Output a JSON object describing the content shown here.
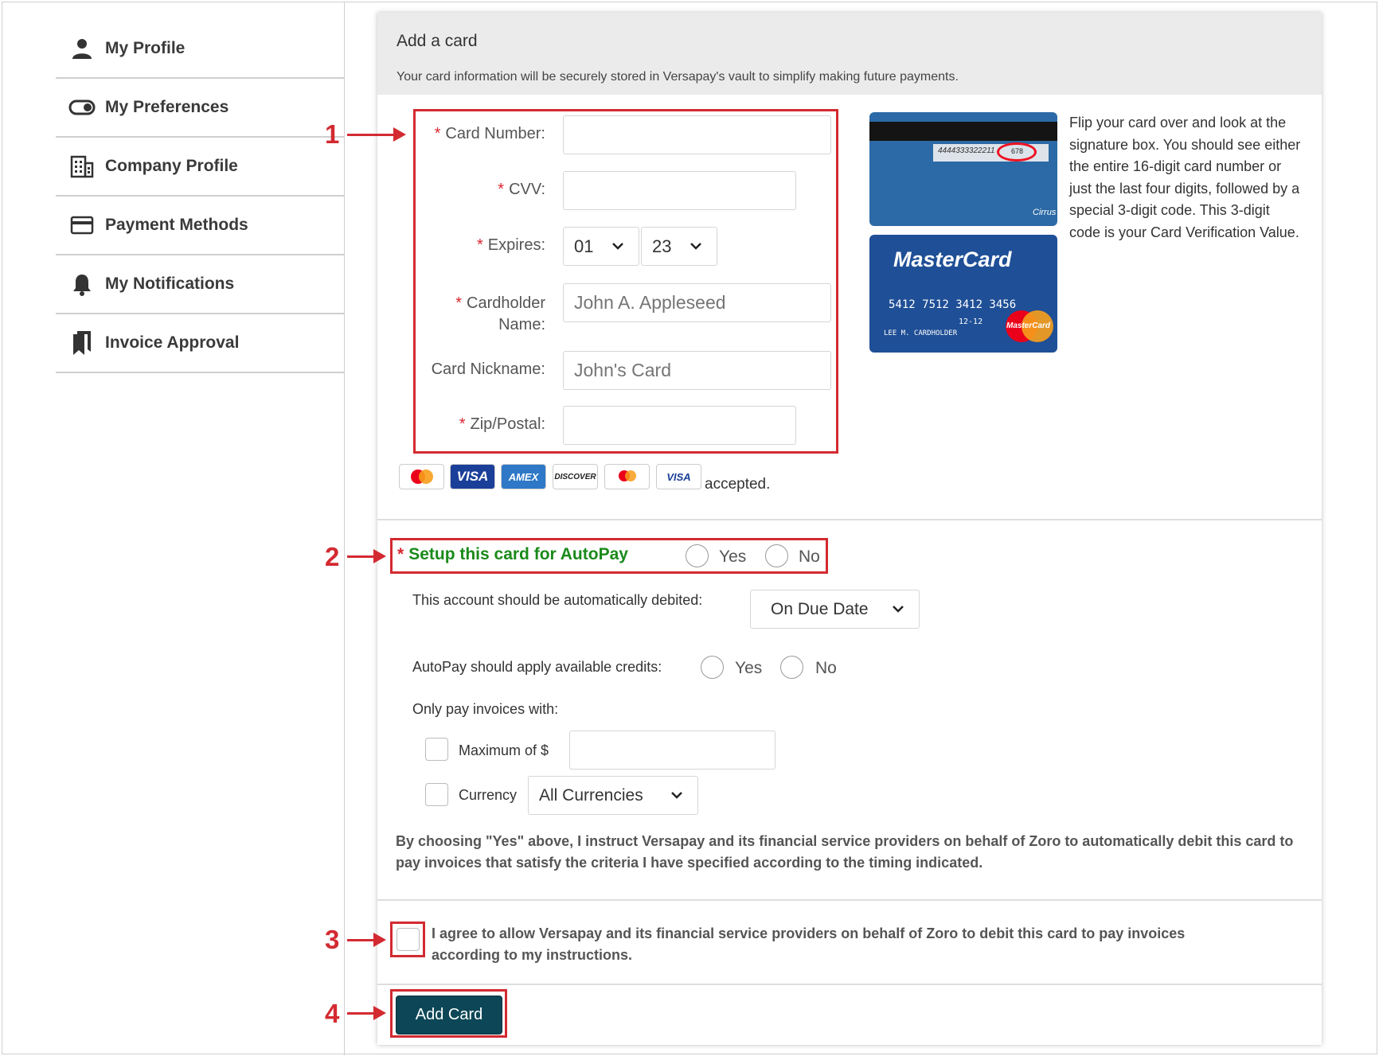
{
  "sidebar": {
    "items": [
      {
        "label": "My Profile",
        "icon": "person-icon"
      },
      {
        "label": "My Preferences",
        "icon": "toggle-icon"
      },
      {
        "label": "Company Profile",
        "icon": "building-icon"
      },
      {
        "label": "Payment Methods",
        "icon": "credit-card-icon"
      },
      {
        "label": "My Notifications",
        "icon": "bell-icon"
      },
      {
        "label": "Invoice Approval",
        "icon": "bookmarks-icon"
      }
    ]
  },
  "card_form": {
    "title": "Add a card",
    "subtitle": "Your card information will be securely stored in Versapay's vault to simplify making future payments.",
    "card_number_label": "Card Number:",
    "cvv_label": "CVV:",
    "expires_label": "Expires:",
    "expires_month": "01",
    "expires_year": "23",
    "cardholder_label_1": "Cardholder",
    "cardholder_label_2": "Name:",
    "cardholder_placeholder": "John A. Appleseed",
    "nickname_label": "Card Nickname:",
    "nickname_placeholder": "John's Card",
    "zip_label": "Zip/Postal:",
    "required_marker": "*",
    "accepted_text": "accepted.",
    "card_logos": [
      "mastercard",
      "VISA",
      "AMEX",
      "DISCOVER",
      "maestro",
      "VISA"
    ],
    "cvv_help": "Flip your card over and look at the signature box. You should see either the entire 16-digit card number or just the last four digits, followed by a special 3-digit code. This 3-digit code is your Card Verification Value.",
    "sample_card": {
      "brand": "MasterCard",
      "number": "5412 7512 3412 3456",
      "expiry": "12-12",
      "holder": "LEE M. CARDHOLDER",
      "back_number": "4444333322211",
      "back_cvv": "678",
      "back_logo": "Cirrus",
      "logo_text": "MasterCard"
    }
  },
  "autopay": {
    "label": "Setup this card for AutoPay",
    "yes": "Yes",
    "no": "No",
    "debit_label": "This account should be automatically debited:",
    "debit_value": "On Due Date",
    "credits_label": "AutoPay should apply available credits:",
    "credits_yes": "Yes",
    "credits_no": "No",
    "only_pay_label": "Only pay invoices with:",
    "maximum_label": "Maximum of $",
    "currency_label": "Currency",
    "currency_value": "All Currencies",
    "disclaimer": "By choosing \"Yes\" above, I instruct Versapay and its financial service providers on behalf of Zoro to automatically debit this card to pay invoices that satisfy the criteria I have specified according to the timing indicated."
  },
  "agreement": {
    "text": "I agree to allow Versapay and its financial service providers on behalf of Zoro to debit this card to pay invoices according to my instructions."
  },
  "submit_label": "Add Card",
  "callouts": [
    "1",
    "2",
    "3",
    "4"
  ],
  "colors": {
    "callout_red": "#d32a31",
    "autopay_green": "#1a8a1a",
    "button_teal": "#0d4757",
    "header_gray": "#ebebeb"
  }
}
